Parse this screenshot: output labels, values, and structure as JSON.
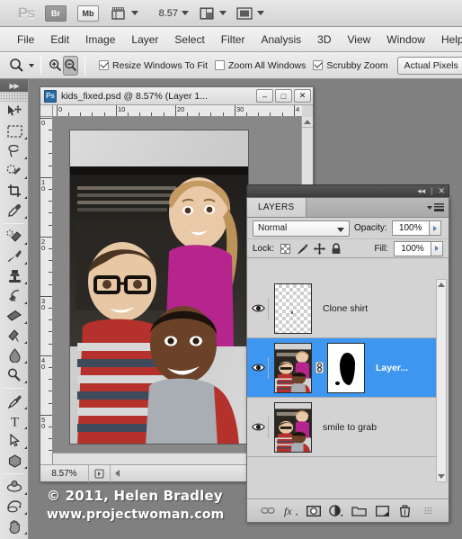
{
  "appbar": {
    "logo": "Ps",
    "bridge_label": "Br",
    "minibridge_label": "Mb",
    "view_extras_icon": "view-extras-icon",
    "zoom_value": "8.57",
    "arrange_icon": "arrange-documents-icon",
    "screenmode_icon": "screen-mode-icon"
  },
  "menubar": {
    "items": [
      {
        "label": "File"
      },
      {
        "label": "Edit"
      },
      {
        "label": "Image"
      },
      {
        "label": "Layer"
      },
      {
        "label": "Select"
      },
      {
        "label": "Filter"
      },
      {
        "label": "Analysis"
      },
      {
        "label": "3D"
      },
      {
        "label": "View"
      },
      {
        "label": "Window"
      },
      {
        "label": "Help"
      }
    ]
  },
  "optionsbar": {
    "tool_icon": "zoom-tool-icon",
    "zoom_in_icon": "zoom-in-icon",
    "zoom_out_icon": "zoom-out-icon",
    "checkboxes": [
      {
        "label": "Resize Windows To Fit",
        "checked": true
      },
      {
        "label": "Zoom All Windows",
        "checked": false
      },
      {
        "label": "Scrubby Zoom",
        "checked": true
      }
    ],
    "actual_pixels_label": "Actual Pixels"
  },
  "toolbar": {
    "collapse_icon": "collapse-panel-icon",
    "tools": [
      {
        "name": "move-tool"
      },
      {
        "name": "rectangular-marquee-tool"
      },
      {
        "name": "lasso-tool"
      },
      {
        "name": "quick-selection-tool"
      },
      {
        "name": "crop-tool"
      },
      {
        "name": "eyedropper-tool"
      },
      {
        "name": "spot-healing-brush-tool"
      },
      {
        "name": "brush-tool"
      },
      {
        "name": "clone-stamp-tool"
      },
      {
        "name": "history-brush-tool"
      },
      {
        "name": "eraser-tool"
      },
      {
        "name": "gradient-tool"
      },
      {
        "name": "blur-tool"
      },
      {
        "name": "dodge-tool"
      },
      {
        "name": "pen-tool"
      },
      {
        "name": "horizontal-type-tool"
      },
      {
        "name": "path-selection-tool"
      },
      {
        "name": "shape-tool"
      },
      {
        "name": "3d-rotate-tool"
      },
      {
        "name": "3d-orbit-tool"
      },
      {
        "name": "hand-tool"
      }
    ]
  },
  "document": {
    "title": "kids_fixed.psd @ 8.57% (Layer 1...",
    "app_icon": "photoshop-document-icon",
    "minimize_label": "–",
    "maximize_label": "□",
    "close_label": "✕",
    "ruler_h_labels": [
      "0",
      "10",
      "20",
      "30",
      "4"
    ],
    "ruler_v_labels": [
      "0",
      "10",
      "20",
      "30",
      "40",
      "50"
    ],
    "status_zoom": "8.57%",
    "status_doc_icon": "document-info-icon",
    "canvas_alt": "photo of three children"
  },
  "layers_panel": {
    "collapse_icon": "collapse-dock-icon",
    "close_icon": "close-panel-icon",
    "tab_label": "LAYERS",
    "menu_icon": "panel-menu-icon",
    "blend_mode": "Normal",
    "opacity_label": "Opacity:",
    "opacity_value": "100%",
    "lock_label": "Lock:",
    "lock_icons": [
      "lock-transparent-pixels-icon",
      "lock-image-pixels-icon",
      "lock-position-icon",
      "lock-all-icon"
    ],
    "fill_label": "Fill:",
    "fill_value": "100%",
    "rows": [
      {
        "name": "Clone shirt",
        "visible": true,
        "selected": false,
        "thumb_type": "transparent",
        "has_mask": false
      },
      {
        "name": "Layer...",
        "visible": true,
        "selected": true,
        "thumb_type": "photo",
        "has_mask": true,
        "link_icon": "link-layers-icon"
      },
      {
        "name": "smile to grab",
        "visible": true,
        "selected": false,
        "thumb_type": "photo",
        "has_mask": false
      }
    ],
    "bottom_buttons": [
      {
        "name": "link-layers-icon",
        "label": "∞"
      },
      {
        "name": "layer-style-fx-icon",
        "label": "fx"
      },
      {
        "name": "add-layer-mask-icon",
        "label": "▢"
      },
      {
        "name": "new-adjustment-layer-icon",
        "label": "◑"
      },
      {
        "name": "new-group-icon",
        "label": "▱"
      },
      {
        "name": "new-layer-icon",
        "label": "⧉"
      },
      {
        "name": "delete-layer-icon",
        "label": "⌧"
      }
    ],
    "scroll_up_icon": "scroll-up-arrow-icon",
    "scroll_down_icon": "scroll-down-arrow-icon"
  },
  "watermark": {
    "line1": "© 2011, Helen Bradley",
    "line2": "www.projectwoman.com"
  },
  "colors": {
    "selection_blue": "#3d96f0",
    "panel_gray": "#d3d3d3",
    "desktop_gray": "#808080"
  }
}
